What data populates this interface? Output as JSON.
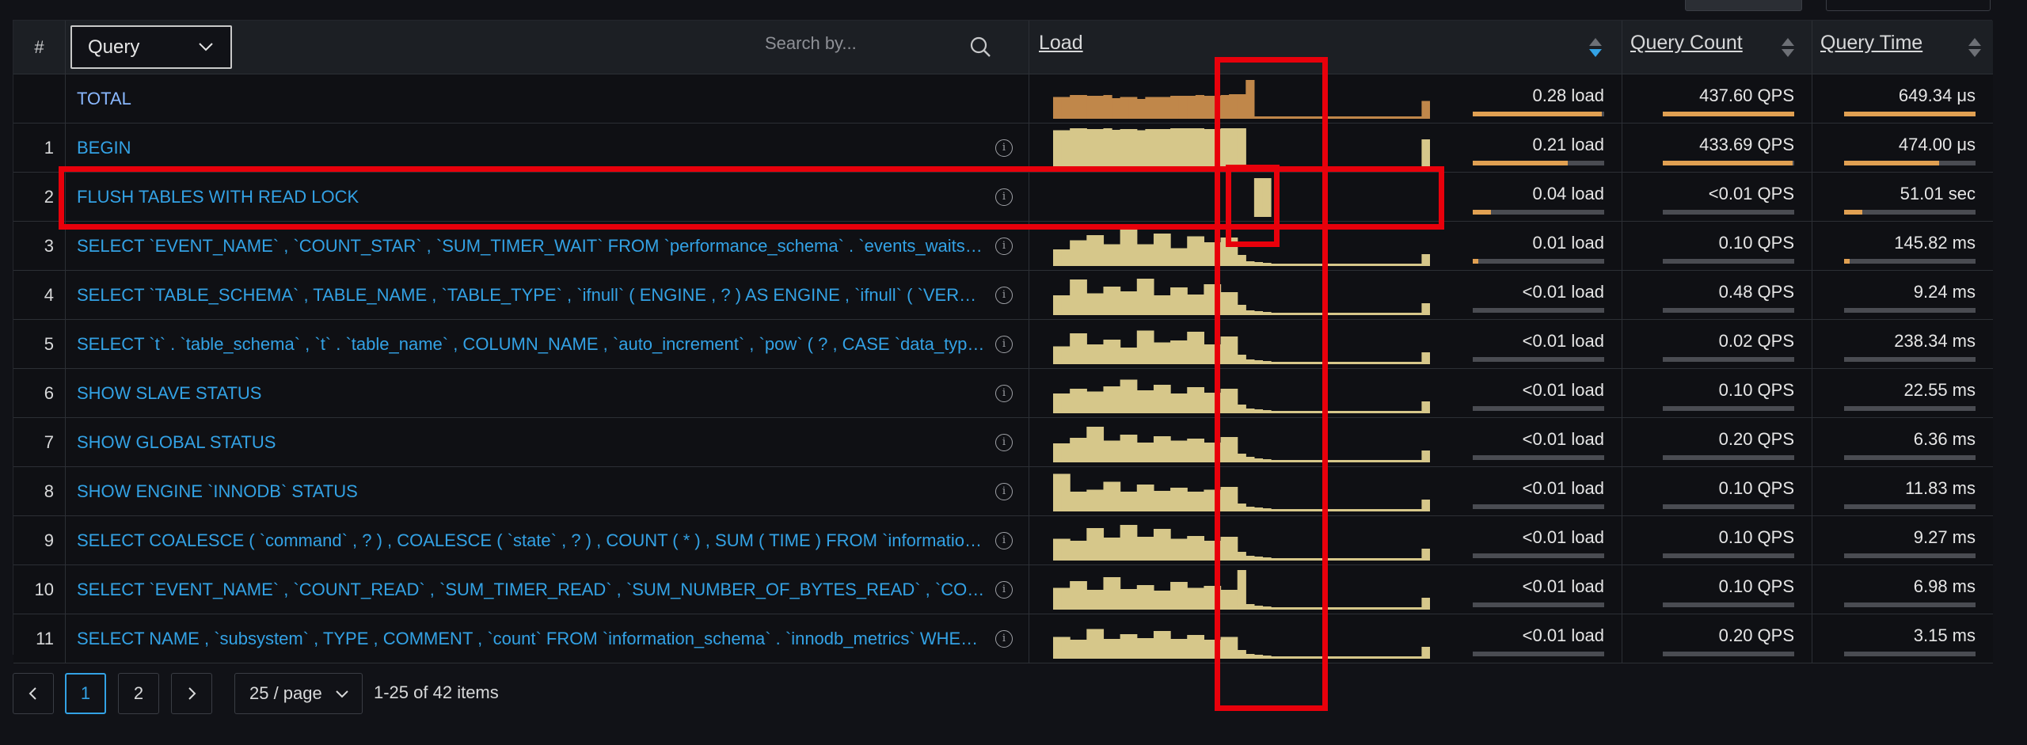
{
  "header": {
    "hash": "#",
    "query_select": "Query",
    "search_placeholder": "Search by...",
    "load_title": "Load",
    "count_title": "Query Count",
    "time_title": "Query Time"
  },
  "rows": [
    {
      "num": "",
      "query": "TOTAL",
      "load": "0.28 load",
      "load_frac": 0.98,
      "count": "437.60 QPS",
      "count_frac": 1.0,
      "time": "649.34 μs",
      "time_frac": 1.0,
      "spark": [
        0.55,
        0.55,
        0.6,
        0.6,
        0.58,
        0.58,
        0.6,
        0.52,
        0.55,
        0.55,
        0.5,
        0.55,
        0.55,
        0.55,
        0.58,
        0.58,
        0.58,
        0.6,
        0.58,
        0.58,
        0.6,
        0.62,
        0.62,
        0.98,
        0.06,
        0.06,
        0.06,
        0.06,
        0.06,
        0.06,
        0.06,
        0.06,
        0.06,
        0.06,
        0.06,
        0.06,
        0.06,
        0.06,
        0.06,
        0.06,
        0.06,
        0.06,
        0.06,
        0.06,
        0.45
      ],
      "spark_color": "#c0874a"
    },
    {
      "num": "1",
      "query": "BEGIN",
      "load": "0.21 load",
      "load_frac": 0.72,
      "count": "433.69 QPS",
      "count_frac": 0.99,
      "time": "474.00 μs",
      "time_frac": 0.72,
      "spark": [
        0.95,
        0.95,
        1,
        1,
        0.98,
        0.98,
        1,
        0.96,
        0.98,
        0.98,
        0.95,
        0.98,
        0.98,
        0.98,
        1,
        1,
        1,
        1,
        0.98,
        0.98,
        1,
        1,
        1,
        0,
        0,
        0,
        0,
        0,
        0,
        0,
        0,
        0,
        0,
        0,
        0,
        0,
        0,
        0,
        0,
        0,
        0,
        0,
        0,
        0,
        0.72
      ],
      "spark_color": "#d6c78a"
    },
    {
      "num": "2",
      "query": "FLUSH TABLES WITH READ LOCK",
      "load": "0.04 load",
      "load_frac": 0.14,
      "count": "<0.01 QPS",
      "count_frac": 0.0,
      "time": "51.01 sec",
      "time_frac": 0.14,
      "spark": [
        0,
        0,
        0,
        0,
        0,
        0,
        0,
        0,
        0,
        0,
        0,
        0,
        0,
        0,
        0,
        0,
        0,
        0,
        0,
        0,
        0,
        0,
        0,
        0,
        0.98,
        0.98,
        0,
        0,
        0,
        0,
        0,
        0,
        0,
        0,
        0,
        0,
        0,
        0,
        0,
        0,
        0,
        0,
        0,
        0,
        0
      ],
      "spark_color": "#d6c78a"
    },
    {
      "num": "3",
      "query": "SELECT `EVENT_NAME` , `COUNT_STAR` , `SUM_TIMER_WAIT` FROM `performance_schema` . `events_waits_summary_global_by_event_name`",
      "load": "0.01 load",
      "load_frac": 0.04,
      "count": "0.10 QPS",
      "count_frac": 0.0,
      "time": "145.82 ms",
      "time_frac": 0.04,
      "spark": [
        0.42,
        0.42,
        0.65,
        0.65,
        0.78,
        0.78,
        0.55,
        0.55,
        0.95,
        0.95,
        0.55,
        0.55,
        0.82,
        0.82,
        0.45,
        0.45,
        0.75,
        0.75,
        0.6,
        0.6,
        0.72,
        0.72,
        0.28,
        0.12,
        0.1,
        0.08,
        0.06,
        0.06,
        0.06,
        0.06,
        0.06,
        0.06,
        0.06,
        0.06,
        0.06,
        0.06,
        0.06,
        0.06,
        0.06,
        0.06,
        0.06,
        0.06,
        0.06,
        0.06,
        0.3
      ],
      "spark_color": "#d6c78a"
    },
    {
      "num": "4",
      "query": "SELECT `TABLE_SCHEMA` , TABLE_NAME , `TABLE_TYPE` , `ifnull` ( ENGINE , ? ) AS ENGINE , `ifnull` ( `VERSION` , ? ) AS VERSION",
      "load": "<0.01 load",
      "load_frac": 0.0,
      "count": "0.48 QPS",
      "count_frac": 0.0,
      "time": "9.24 ms",
      "time_frac": 0.0,
      "spark": [
        0.5,
        0.5,
        0.9,
        0.9,
        0.55,
        0.55,
        0.72,
        0.72,
        0.6,
        0.6,
        0.92,
        0.92,
        0.5,
        0.5,
        0.7,
        0.7,
        0.52,
        0.52,
        0.78,
        0.78,
        0.58,
        0.58,
        0.26,
        0.12,
        0.1,
        0.08,
        0.06,
        0.06,
        0.06,
        0.06,
        0.06,
        0.06,
        0.06,
        0.06,
        0.06,
        0.06,
        0.06,
        0.06,
        0.06,
        0.06,
        0.06,
        0.06,
        0.06,
        0.06,
        0.3
      ],
      "spark_color": "#d6c78a"
    },
    {
      "num": "5",
      "query": "SELECT `t` . `table_schema` , `t` . `table_name` , COLUMN_NAME , `auto_increment` , `pow` ( ? , CASE `data_type` WHEN ...",
      "load": "<0.01 load",
      "load_frac": 0.0,
      "count": "0.02 QPS",
      "count_frac": 0.0,
      "time": "238.34 ms",
      "time_frac": 0.0,
      "spark": [
        0.45,
        0.45,
        0.78,
        0.78,
        0.5,
        0.5,
        0.62,
        0.62,
        0.42,
        0.42,
        0.85,
        0.85,
        0.55,
        0.55,
        0.6,
        0.6,
        0.82,
        0.82,
        0.5,
        0.5,
        0.7,
        0.7,
        0.24,
        0.12,
        0.1,
        0.08,
        0.06,
        0.06,
        0.06,
        0.06,
        0.06,
        0.06,
        0.06,
        0.06,
        0.06,
        0.06,
        0.06,
        0.06,
        0.06,
        0.06,
        0.06,
        0.06,
        0.06,
        0.06,
        0.3
      ],
      "spark_color": "#d6c78a"
    },
    {
      "num": "6",
      "query": "SHOW SLAVE STATUS",
      "load": "<0.01 load",
      "load_frac": 0.0,
      "count": "0.10 QPS",
      "count_frac": 0.0,
      "time": "22.55 ms",
      "time_frac": 0.0,
      "spark": [
        0.5,
        0.5,
        0.62,
        0.62,
        0.55,
        0.55,
        0.68,
        0.68,
        0.85,
        0.85,
        0.58,
        0.58,
        0.72,
        0.72,
        0.5,
        0.5,
        0.66,
        0.66,
        0.52,
        0.52,
        0.62,
        0.62,
        0.22,
        0.12,
        0.1,
        0.08,
        0.06,
        0.06,
        0.06,
        0.06,
        0.06,
        0.06,
        0.06,
        0.06,
        0.06,
        0.06,
        0.06,
        0.06,
        0.06,
        0.06,
        0.06,
        0.06,
        0.06,
        0.06,
        0.3
      ],
      "spark_color": "#d6c78a"
    },
    {
      "num": "7",
      "query": "SHOW GLOBAL STATUS",
      "load": "<0.01 load",
      "load_frac": 0.0,
      "count": "0.20 QPS",
      "count_frac": 0.0,
      "time": "6.36 ms",
      "time_frac": 0.0,
      "spark": [
        0.48,
        0.48,
        0.62,
        0.62,
        0.9,
        0.9,
        0.55,
        0.55,
        0.7,
        0.7,
        0.5,
        0.5,
        0.66,
        0.66,
        0.55,
        0.55,
        0.6,
        0.6,
        0.5,
        0.5,
        0.64,
        0.64,
        0.22,
        0.14,
        0.1,
        0.08,
        0.06,
        0.06,
        0.06,
        0.06,
        0.06,
        0.06,
        0.06,
        0.06,
        0.06,
        0.06,
        0.06,
        0.06,
        0.06,
        0.06,
        0.06,
        0.06,
        0.06,
        0.06,
        0.3
      ],
      "spark_color": "#d6c78a"
    },
    {
      "num": "8",
      "query": "SHOW ENGINE `INNODB` STATUS",
      "load": "<0.01 load",
      "load_frac": 0.0,
      "count": "0.10 QPS",
      "count_frac": 0.0,
      "time": "11.83 ms",
      "time_frac": 0.0,
      "spark": [
        0.95,
        0.95,
        0.5,
        0.5,
        0.55,
        0.55,
        0.75,
        0.75,
        0.5,
        0.5,
        0.68,
        0.68,
        0.52,
        0.52,
        0.6,
        0.6,
        0.5,
        0.5,
        0.55,
        0.55,
        0.62,
        0.62,
        0.2,
        0.12,
        0.1,
        0.08,
        0.06,
        0.06,
        0.06,
        0.06,
        0.06,
        0.06,
        0.06,
        0.06,
        0.06,
        0.06,
        0.06,
        0.06,
        0.06,
        0.06,
        0.06,
        0.06,
        0.06,
        0.06,
        0.3
      ],
      "spark_color": "#d6c78a"
    },
    {
      "num": "9",
      "query": "SELECT COALESCE ( `command` , ? ) , COALESCE ( `state` , ? ) , COUNT ( * ) , SUM ( TIME ) FROM `information_schema` . `processlist`",
      "load": "<0.01 load",
      "load_frac": 0.0,
      "count": "0.10 QPS",
      "count_frac": 0.0,
      "time": "9.27 ms",
      "time_frac": 0.0,
      "spark": [
        0.55,
        0.55,
        0.5,
        0.5,
        0.82,
        0.82,
        0.58,
        0.58,
        0.9,
        0.9,
        0.6,
        0.6,
        0.8,
        0.8,
        0.55,
        0.55,
        0.62,
        0.62,
        0.5,
        0.5,
        0.6,
        0.6,
        0.22,
        0.12,
        0.1,
        0.08,
        0.06,
        0.06,
        0.06,
        0.06,
        0.06,
        0.06,
        0.06,
        0.06,
        0.06,
        0.06,
        0.06,
        0.06,
        0.06,
        0.06,
        0.06,
        0.06,
        0.06,
        0.06,
        0.3
      ],
      "spark_color": "#d6c78a"
    },
    {
      "num": "10",
      "query": "SELECT `EVENT_NAME` , `COUNT_READ` , `SUM_TIMER_READ` , `SUM_NUMBER_OF_BYTES_READ` , `COUNT_WRITE`",
      "load": "<0.01 load",
      "load_frac": 0.0,
      "count": "0.10 QPS",
      "count_frac": 0.0,
      "time": "6.98 ms",
      "time_frac": 0.0,
      "spark": [
        0.55,
        0.55,
        0.72,
        0.72,
        0.5,
        0.5,
        0.82,
        0.82,
        0.52,
        0.52,
        0.62,
        0.62,
        0.48,
        0.48,
        0.7,
        0.7,
        0.55,
        0.55,
        0.6,
        0.6,
        0.5,
        0.5,
        1,
        0.14,
        0.1,
        0.08,
        0.06,
        0.06,
        0.06,
        0.06,
        0.06,
        0.06,
        0.06,
        0.06,
        0.06,
        0.06,
        0.06,
        0.06,
        0.06,
        0.06,
        0.06,
        0.06,
        0.06,
        0.06,
        0.3
      ],
      "spark_color": "#d6c78a"
    },
    {
      "num": "11",
      "query": "SELECT NAME , `subsystem` , TYPE , COMMENT , `count` FROM `information_schema` . `innodb_metrics` WHERE `status` = ?",
      "load": "<0.01 load",
      "load_frac": 0.0,
      "count": "0.20 QPS",
      "count_frac": 0.0,
      "time": "3.15 ms",
      "time_frac": 0.0,
      "spark": [
        0.55,
        0.55,
        0.48,
        0.48,
        0.75,
        0.75,
        0.5,
        0.5,
        0.62,
        0.62,
        0.52,
        0.52,
        0.7,
        0.7,
        0.5,
        0.5,
        0.6,
        0.6,
        0.48,
        0.48,
        0.55,
        0.55,
        0.22,
        0.12,
        0.1,
        0.08,
        0.06,
        0.06,
        0.06,
        0.06,
        0.06,
        0.06,
        0.06,
        0.06,
        0.06,
        0.06,
        0.06,
        0.06,
        0.06,
        0.06,
        0.06,
        0.06,
        0.06,
        0.06,
        0.3
      ],
      "spark_color": "#d6c78a"
    }
  ],
  "pagination": {
    "prev": "<",
    "page1": "1",
    "page2": "2",
    "next": ">",
    "page_size": "25 / page",
    "total": "1-25 of 42 items"
  },
  "colors": {
    "link": "#33a2e5",
    "annotation": "#e8000b",
    "bar_fill": "#e0a052"
  }
}
